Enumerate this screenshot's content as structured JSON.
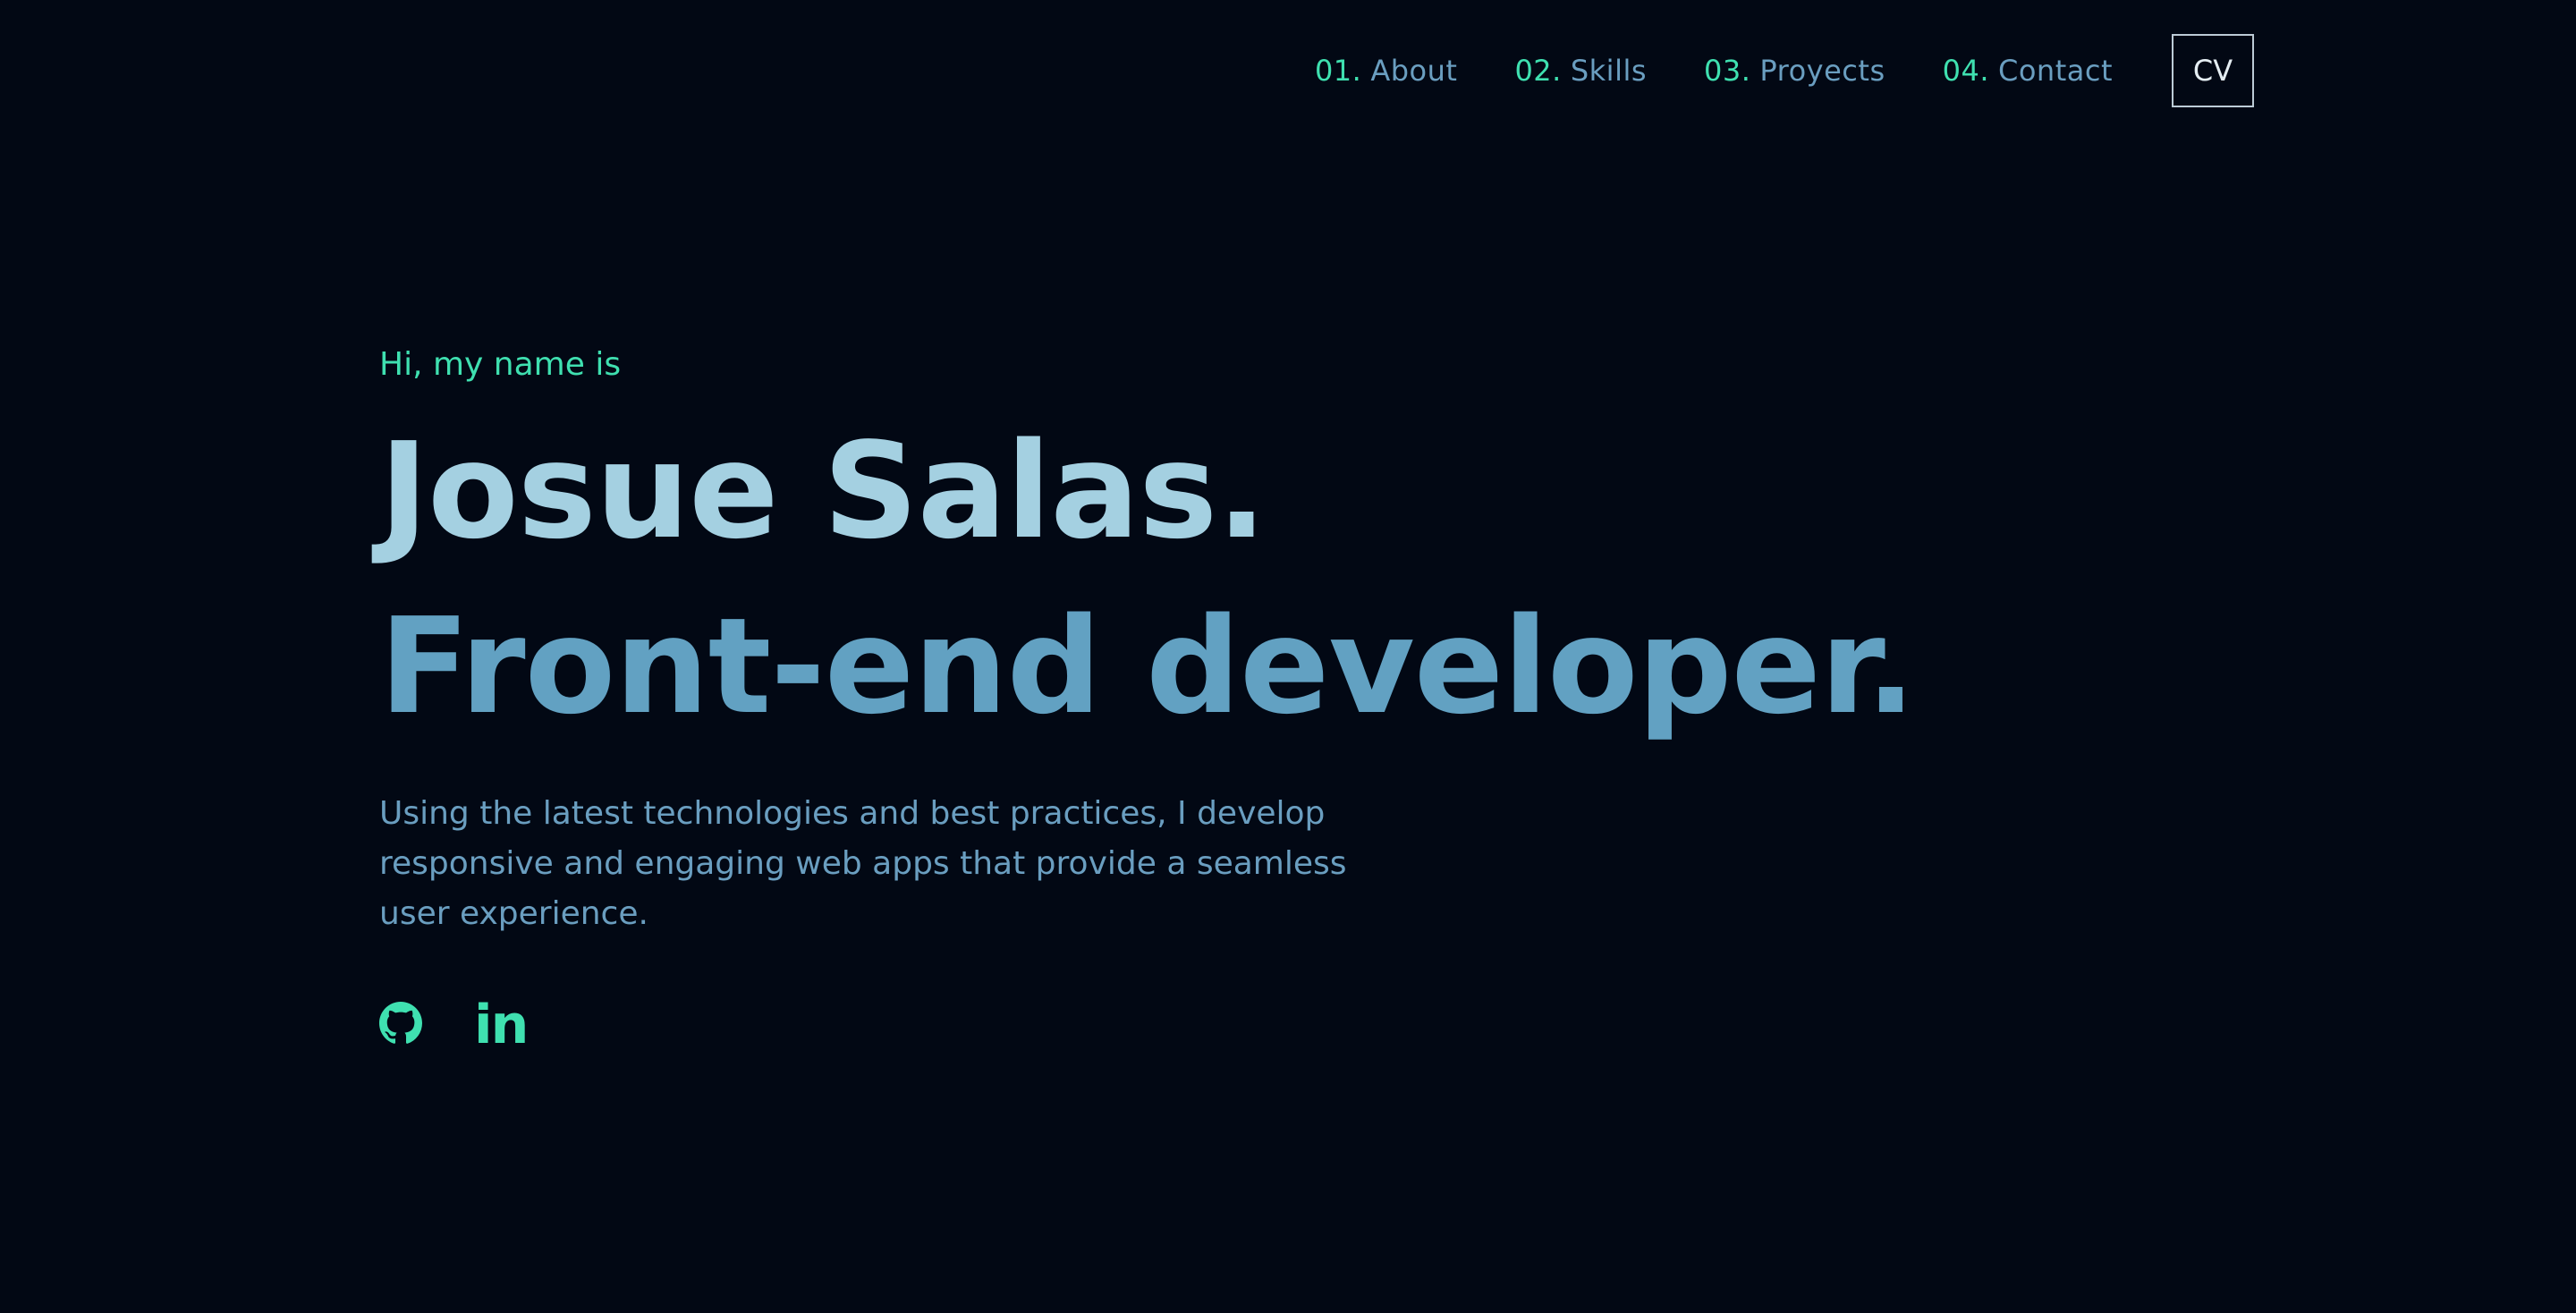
{
  "nav": {
    "items": [
      {
        "num": "01.",
        "label": "About"
      },
      {
        "num": "02.",
        "label": "Skills"
      },
      {
        "num": "03.",
        "label": "Proyects"
      },
      {
        "num": "04.",
        "label": "Contact"
      }
    ],
    "cv_label": "CV"
  },
  "hero": {
    "greeting": "Hi, my name is",
    "name": "Josue Salas.",
    "role": "Front-end developer.",
    "description": "Using the latest technologies and best practices, I develop responsive and engaging web apps that provide a seamless user experience."
  },
  "socials": {
    "github_icon": "github-icon",
    "linkedin_icon": "linkedin-icon",
    "linkedin_glyph": "in"
  },
  "colors": {
    "background": "#020814",
    "accent": "#3fe0b0",
    "name": "#a4d0e1",
    "role": "#62a1c2",
    "text": "#6a9ec0"
  }
}
